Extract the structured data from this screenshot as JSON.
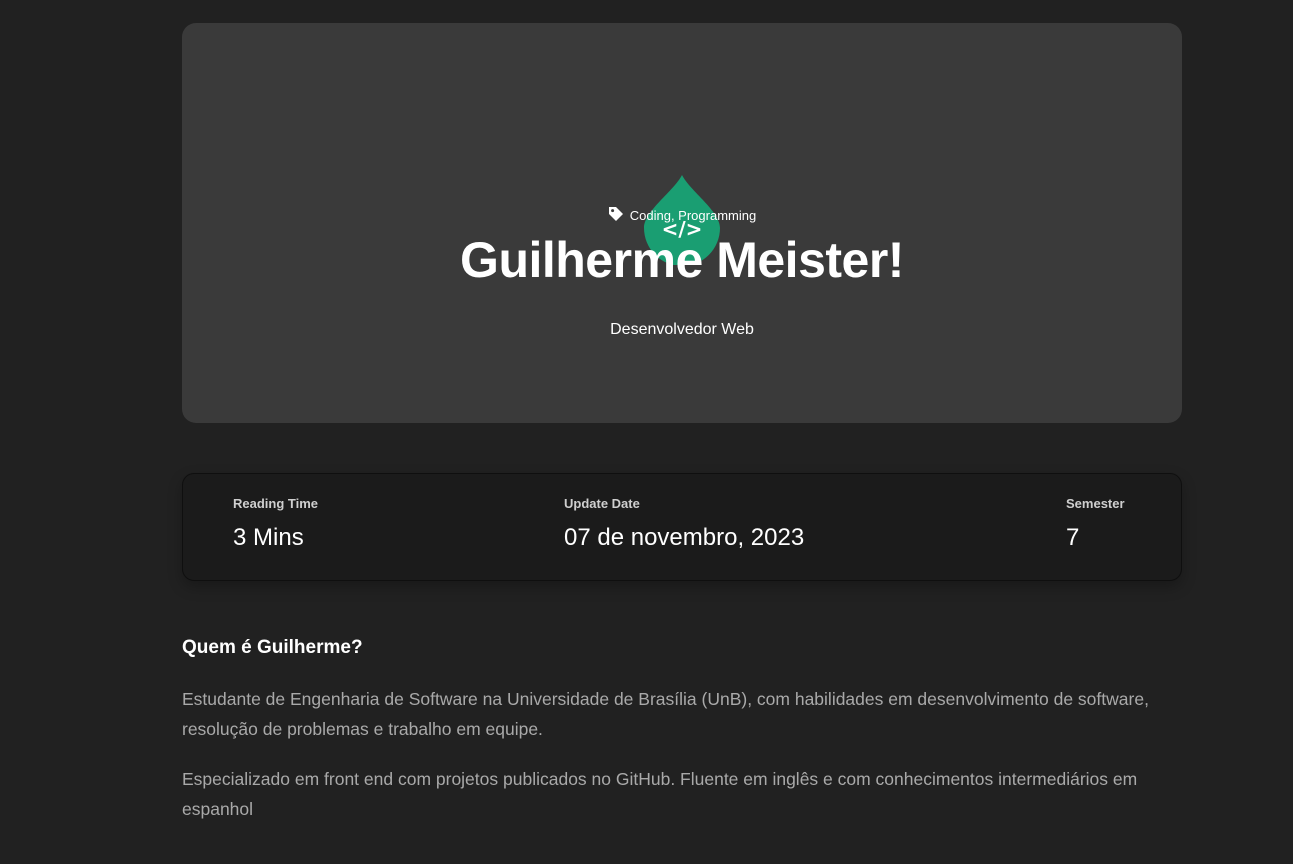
{
  "hero": {
    "tags": "Coding, Programming",
    "title": "Guilherme Meister!",
    "subtitle": "Desenvolvedor Web",
    "icon_color": "#1a9e72"
  },
  "stats": [
    {
      "label": "Reading Time",
      "value": "3 Mins"
    },
    {
      "label": "Update Date",
      "value": "07 de novembro, 2023"
    },
    {
      "label": "Semester",
      "value": "7"
    }
  ],
  "content": {
    "heading": "Quem é Guilherme?",
    "paragraphs": [
      "Estudante de Engenharia de Software na Universidade de Brasília (UnB), com habilidades em desenvolvimento de software, resolução de problemas e trabalho em equipe.",
      "Especializado em front end com projetos publicados no GitHub. Fluente em inglês e com conhecimentos intermediários em espanhol"
    ]
  },
  "icons": {
    "tag": "tag-icon",
    "code": "code-drop-icon"
  }
}
